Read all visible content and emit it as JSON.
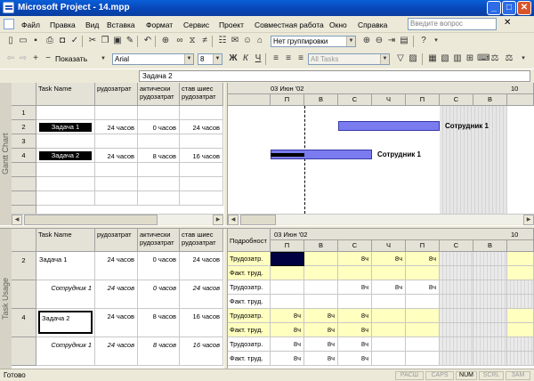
{
  "window": {
    "title": "Microsoft Project - 14.mpp",
    "controls": [
      "_",
      "□",
      "✕"
    ]
  },
  "menu": {
    "items": [
      "Файл",
      "Правка",
      "Вид",
      "Вставка",
      "Формат",
      "Сервис",
      "Проект",
      "Совместная работа",
      "Окно",
      "Справка"
    ],
    "help_placeholder": "Введите вопрос"
  },
  "toolbar1": {
    "grouping": "Нет группировки"
  },
  "toolbar2": {
    "show_label": "Показать",
    "font": "Arial",
    "size": "8",
    "bold": "Ж",
    "italic": "К",
    "underline": "Ч",
    "filter": "All Tasks"
  },
  "entry": {
    "value": "Задача 2"
  },
  "gantt": {
    "side_label": "Gantt Chart",
    "columns": [
      "Task Name",
      "Трудозатраты",
      "Фактические трудозатраты",
      "Оставшиеся трудозатраты"
    ],
    "col_display": [
      "Task Name",
      "рудозатрат",
      "актически рудозатрат",
      "став шиес рудозатрат"
    ],
    "rows": [
      {
        "num": "1",
        "name": "",
        "work": "",
        "act": "",
        "rem": ""
      },
      {
        "num": "2",
        "name": "Задача 1",
        "work": "24 часов",
        "act": "0 часов",
        "rem": "24 часов"
      },
      {
        "num": "3",
        "name": "",
        "work": "",
        "act": "",
        "rem": ""
      },
      {
        "num": "4",
        "name": "Задача 2",
        "work": "24 часов",
        "act": "8 часов",
        "rem": "16 часов"
      }
    ],
    "timescale": {
      "week": "03 Июн '02",
      "next_week": "10",
      "days": [
        "П",
        "В",
        "С",
        "Ч",
        "П",
        "С",
        "В"
      ]
    },
    "bar_labels": [
      "Сотрудник 1",
      "Сотрудник 1"
    ]
  },
  "usage": {
    "side_label": "Task Usage",
    "columns": [
      "Task Name",
      "рудозатрат",
      "актически рудозатрат",
      "став шиес рудозатрат"
    ],
    "details_header": "Подробност",
    "rows": [
      {
        "num": "2",
        "name": "Задача 1",
        "work": "24 часов",
        "act": "0 часов",
        "rem": "24 часов",
        "italic": false
      },
      {
        "num": "",
        "name": "Сотрудник 1",
        "work": "24 часов",
        "act": "0 часов",
        "rem": "24 часов",
        "italic": true
      },
      {
        "num": "4",
        "name": "Задача 2",
        "work": "24 часов",
        "act": "8 часов",
        "rem": "16 часов",
        "italic": false
      },
      {
        "num": "",
        "name": "Сотрудник 1",
        "work": "24 часов",
        "act": "8 часов",
        "rem": "16 часов",
        "italic": true
      }
    ],
    "detail_labels": [
      "Трудозатр.",
      "Факт. труд.",
      "Трудозатр.",
      "Факт. труд.",
      "Трудозатр.",
      "Факт. труд.",
      "Трудозатр.",
      "Факт. труд."
    ],
    "timescale": {
      "week": "03 Июн '02",
      "next_week": "10",
      "days": [
        "П",
        "В",
        "С",
        "Ч",
        "П",
        "С",
        "В"
      ]
    },
    "grid_values": [
      [
        "",
        "",
        "8ч",
        "8ч",
        "8ч",
        "",
        ""
      ],
      [
        "",
        "",
        "",
        "",
        "",
        "",
        ""
      ],
      [
        "",
        "",
        "8ч",
        "8ч",
        "8ч",
        "",
        ""
      ],
      [
        "",
        "",
        "",
        "",
        "",
        "",
        ""
      ],
      [
        "8ч",
        "8ч",
        "8ч",
        "",
        "",
        "",
        ""
      ],
      [
        "8ч",
        "8ч",
        "8ч",
        "",
        "",
        "",
        ""
      ],
      [
        "8ч",
        "8ч",
        "8ч",
        "",
        "",
        "",
        ""
      ],
      [
        "8ч",
        "8ч",
        "8ч",
        "",
        "",
        "",
        ""
      ]
    ]
  },
  "status": {
    "ready": "Готово",
    "indicators": [
      "РАСШ",
      "CAPS",
      "NUM",
      "SCRL",
      "ЗАМ"
    ]
  },
  "colors": {
    "title": "#0a5fd8",
    "bar": "#7b7bf0",
    "highlight": "#ffffc0",
    "selected": "#000000"
  }
}
